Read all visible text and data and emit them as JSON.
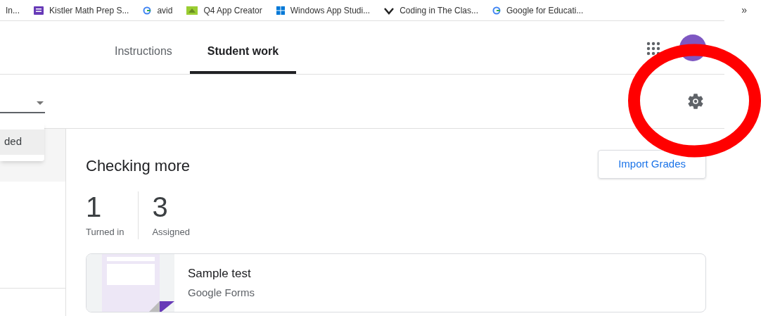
{
  "bookmarks": [
    {
      "label": "In...",
      "kind": "none"
    },
    {
      "label": "Kistler Math Prep S...",
      "kind": "form"
    },
    {
      "label": "avid",
      "kind": "google"
    },
    {
      "label": "Q4 App Creator",
      "kind": "app"
    },
    {
      "label": "Windows App Studi...",
      "kind": "windows"
    },
    {
      "label": "Coding in The Clas...",
      "kind": "code"
    },
    {
      "label": "Google for Educati...",
      "kind": "google"
    }
  ],
  "bookmarks_more": "»",
  "tabs": [
    {
      "label": "Instructions",
      "selected": false
    },
    {
      "label": "Student work",
      "selected": true
    }
  ],
  "filter_menu": {
    "items": [
      {
        "label": "ded",
        "selected": true
      }
    ]
  },
  "assignment": {
    "title": "Checking more",
    "button": "Import Grades",
    "stats": [
      {
        "value": "1",
        "label": "Turned in"
      },
      {
        "value": "3",
        "label": "Assigned"
      }
    ],
    "attachment": {
      "title": "Sample test",
      "type": "Google Forms"
    }
  }
}
